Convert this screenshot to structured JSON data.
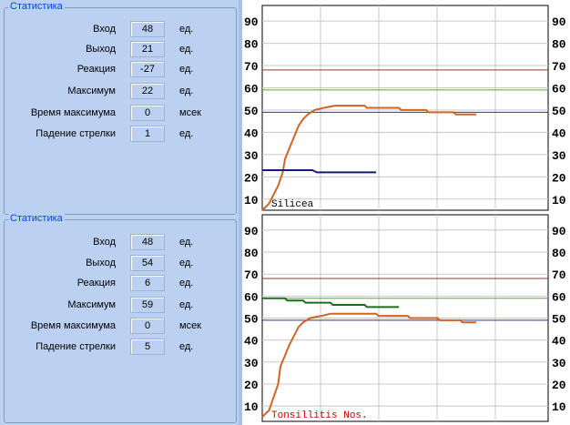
{
  "panels": [
    {
      "title": "Статистика",
      "rows": [
        {
          "label": "Вход",
          "value": "48",
          "unit": "ед."
        },
        {
          "label": "Выход",
          "value": "21",
          "unit": "ед."
        },
        {
          "label": "Реакция",
          "value": "-27",
          "unit": "ед."
        },
        {
          "label": "Максимум",
          "value": "22",
          "unit": "ед."
        },
        {
          "label": "Время максимума",
          "value": "0",
          "unit": "мсек"
        },
        {
          "label": "Падение стрелки",
          "value": "1",
          "unit": "ед."
        }
      ]
    },
    {
      "title": "Статистика",
      "rows": [
        {
          "label": "Вход",
          "value": "48",
          "unit": "ед."
        },
        {
          "label": "Выход",
          "value": "54",
          "unit": "ед."
        },
        {
          "label": "Реакция",
          "value": "6",
          "unit": "ед."
        },
        {
          "label": "Максимум",
          "value": "59",
          "unit": "ед."
        },
        {
          "label": "Время максимума",
          "value": "0",
          "unit": "мсек"
        },
        {
          "label": "Падение стрелки",
          "value": "5",
          "unit": "ед."
        }
      ]
    }
  ],
  "chart_data": [
    {
      "type": "line",
      "caption": "Silicea",
      "caption_color": "#000000",
      "ylim": [
        5,
        97
      ],
      "yticks": [
        10,
        20,
        30,
        40,
        50,
        60,
        70,
        80,
        90
      ],
      "xlim": [
        0,
        100
      ],
      "x_gridlines": 5,
      "hlines": [
        {
          "value": 68,
          "color": "#993333"
        },
        {
          "value": 59,
          "color": "#55aa33"
        },
        {
          "value": 49,
          "color": "#333399"
        }
      ],
      "series": [
        {
          "color": "#cc6622",
          "points": [
            [
              0,
              5
            ],
            [
              3,
              8
            ],
            [
              5,
              12
            ],
            [
              7,
              16
            ],
            [
              9,
              22
            ],
            [
              10,
              28
            ],
            [
              12,
              33
            ],
            [
              14,
              38
            ],
            [
              16,
              43
            ],
            [
              18,
              46
            ],
            [
              20,
              48
            ],
            [
              23,
              50
            ],
            [
              27,
              51
            ],
            [
              32,
              52
            ],
            [
              45,
              52
            ],
            [
              46,
              51
            ],
            [
              60,
              51
            ],
            [
              61,
              50
            ],
            [
              72,
              50
            ],
            [
              73,
              49
            ],
            [
              84,
              49
            ],
            [
              85,
              48
            ],
            [
              94,
              48
            ]
          ]
        },
        {
          "color": "#1a1a6e",
          "points": [
            [
              0,
              23
            ],
            [
              22,
              23
            ],
            [
              24,
              22
            ],
            [
              50,
              22
            ]
          ]
        }
      ]
    },
    {
      "type": "line",
      "caption": "Tonsillitis Nos.",
      "caption_color": "#cc0000",
      "ylim": [
        3,
        97
      ],
      "yticks": [
        10,
        20,
        30,
        40,
        50,
        60,
        70,
        80,
        90
      ],
      "xlim": [
        0,
        100
      ],
      "x_gridlines": 5,
      "hlines": [
        {
          "value": 68,
          "color": "#993333"
        },
        {
          "value": 59,
          "color": "#55aa33"
        },
        {
          "value": 49,
          "color": "#333399"
        }
      ],
      "series": [
        {
          "color": "#cc6622",
          "points": [
            [
              0,
              5
            ],
            [
              3,
              8
            ],
            [
              5,
              14
            ],
            [
              7,
              20
            ],
            [
              8,
              28
            ],
            [
              10,
              33
            ],
            [
              12,
              38
            ],
            [
              14,
              42
            ],
            [
              16,
              46
            ],
            [
              18,
              48
            ],
            [
              21,
              50
            ],
            [
              26,
              51
            ],
            [
              30,
              52
            ],
            [
              50,
              52
            ],
            [
              51,
              51
            ],
            [
              64,
              51
            ],
            [
              65,
              50
            ],
            [
              77,
              50
            ],
            [
              78,
              49
            ],
            [
              87,
              49
            ],
            [
              88,
              48
            ],
            [
              94,
              48
            ]
          ]
        },
        {
          "color": "#1a6e1a",
          "points": [
            [
              0,
              59
            ],
            [
              10,
              59
            ],
            [
              11,
              58
            ],
            [
              18,
              58
            ],
            [
              19,
              57
            ],
            [
              30,
              57
            ],
            [
              31,
              56
            ],
            [
              45,
              56
            ],
            [
              46,
              55
            ],
            [
              60,
              55
            ]
          ]
        }
      ]
    }
  ]
}
